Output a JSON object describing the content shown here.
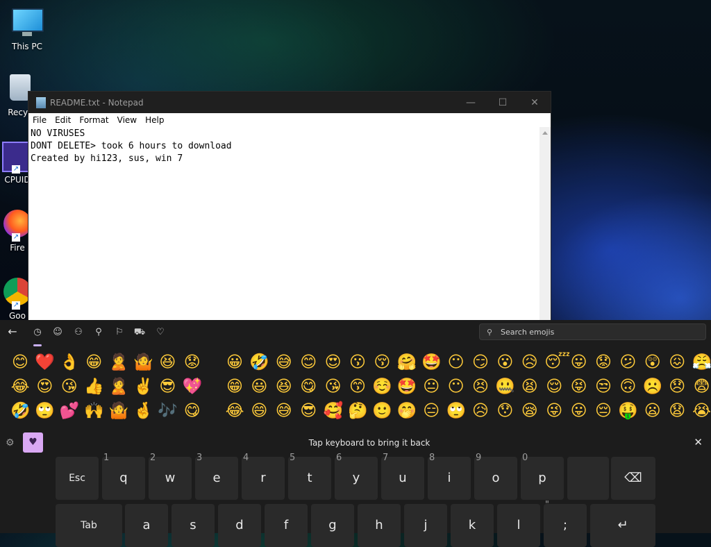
{
  "desktop": {
    "icons": [
      {
        "label": "This PC"
      },
      {
        "label": "Recyc"
      },
      {
        "label": "CPUID"
      },
      {
        "label": "Fire"
      },
      {
        "label": "Goo"
      }
    ]
  },
  "notepad": {
    "title": "README.txt - Notepad",
    "menu": [
      "File",
      "Edit",
      "Format",
      "View",
      "Help"
    ],
    "lines": [
      "NO VIRUSES",
      "DONT DELETE> took 6 hours to download",
      "Created by hi123, sus, win 7"
    ],
    "controls": {
      "minimize": "—",
      "maximize": "☐",
      "close": "✕"
    }
  },
  "emoji_panel": {
    "back_glyph": "←",
    "categories": [
      {
        "icon": "clock-icon",
        "glyph": "◷"
      },
      {
        "icon": "smiley-icon",
        "glyph": "☺"
      },
      {
        "icon": "people-icon",
        "glyph": "⚇"
      },
      {
        "icon": "food-icon",
        "glyph": "⚲"
      },
      {
        "icon": "travel-icon",
        "glyph": "⚐"
      },
      {
        "icon": "car-icon",
        "glyph": "⛟"
      },
      {
        "icon": "heart-icon",
        "glyph": "♡"
      }
    ],
    "search_placeholder": "Search emojis",
    "search_icon_glyph": "⚲",
    "recent": [
      [
        "😊",
        "❤️",
        "👌",
        "😁",
        "🙎",
        "🤷",
        "😆",
        "😟"
      ],
      [
        "😂",
        "😍",
        "😘",
        "👍",
        "🙎",
        "✌️",
        "😎",
        "💖"
      ],
      [
        "🤣",
        "🙄",
        "💕",
        "🙌",
        "🤷",
        "🤞",
        "🎶",
        "😋"
      ]
    ],
    "smileys": [
      [
        "😀",
        "🤣",
        "😅",
        "😊",
        "😍",
        "😗",
        "😚",
        "🤗",
        "🤩",
        "😶",
        "😏",
        "😮",
        "😥",
        "😴",
        "😛",
        "😟",
        "😕",
        "😲",
        "😖",
        "😤"
      ],
      [
        "😁",
        "😃",
        "😆",
        "😋",
        "😘",
        "😙",
        "☺️",
        "🤩",
        "😐",
        "😶",
        "😣",
        "🤐",
        "😫",
        "😌",
        "😝",
        "😒",
        "🙃",
        "☹️",
        "😞",
        "😨"
      ],
      [
        "😂",
        "😄",
        "😅",
        "😎",
        "🥰",
        "🤔",
        "🙂",
        "🤭",
        "😑",
        "🙄",
        "😥",
        "😯",
        "😪",
        "😜",
        "😛",
        "😔",
        "🤑",
        "😦",
        "😧",
        "😭"
      ]
    ],
    "settings_glyph": "⚙",
    "sticker_glyph": "♥",
    "message": "Tap keyboard to bring it back",
    "close_glyph": "✕"
  },
  "keyboard": {
    "row1": [
      {
        "label": "Esc",
        "hint": ""
      },
      {
        "label": "q",
        "hint": "1"
      },
      {
        "label": "w",
        "hint": "2"
      },
      {
        "label": "e",
        "hint": "3"
      },
      {
        "label": "r",
        "hint": "4"
      },
      {
        "label": "t",
        "hint": "5"
      },
      {
        "label": "y",
        "hint": "6"
      },
      {
        "label": "u",
        "hint": "7"
      },
      {
        "label": "i",
        "hint": "8"
      },
      {
        "label": "o",
        "hint": "9"
      },
      {
        "label": "p",
        "hint": "0"
      },
      {
        "label": "",
        "hint": ""
      },
      {
        "label": "⌫",
        "hint": ""
      }
    ],
    "row2": [
      {
        "label": "Tab",
        "hint": ""
      },
      {
        "label": "a",
        "hint": ""
      },
      {
        "label": "s",
        "hint": ""
      },
      {
        "label": "d",
        "hint": ""
      },
      {
        "label": "f",
        "hint": ""
      },
      {
        "label": "g",
        "hint": ""
      },
      {
        "label": "h",
        "hint": ""
      },
      {
        "label": "j",
        "hint": ""
      },
      {
        "label": "k",
        "hint": ""
      },
      {
        "label": "l",
        "hint": ""
      },
      {
        "label": ";",
        "hint": "\""
      },
      {
        "label": "↵",
        "hint": ""
      }
    ]
  }
}
